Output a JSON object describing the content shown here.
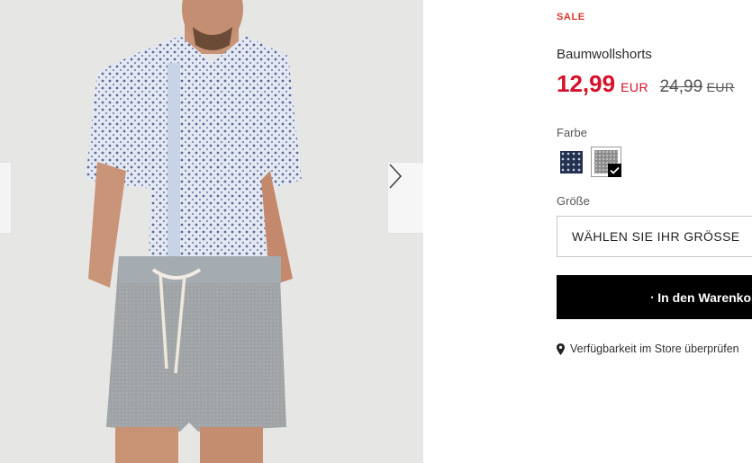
{
  "product": {
    "badge": "SALE",
    "name": "Baumwollshorts",
    "price": "12,99",
    "price_currency": "EUR",
    "old_price": "24,99",
    "old_price_currency": "EUR"
  },
  "color": {
    "label": "Farbe",
    "options": [
      {
        "name": "navy-pattern",
        "color": "#24304f",
        "selected": false
      },
      {
        "name": "grey",
        "color": "#8c8c8c",
        "selected": true
      }
    ]
  },
  "size": {
    "label": "Größe",
    "select_text": "WÄHLEN SIE IHR GRÖSSE"
  },
  "cart": {
    "label": "In den Warenkorb"
  },
  "store_check": {
    "label": "Verfügbarkeit im Store überprüfen"
  },
  "colors": {
    "sale_red": "#d4102a",
    "button_bg": "#000000"
  },
  "icons": [
    "chevron-left-icon",
    "chevron-right-icon",
    "checkmark-icon",
    "shopping-bag-icon",
    "location-pin-icon"
  ]
}
